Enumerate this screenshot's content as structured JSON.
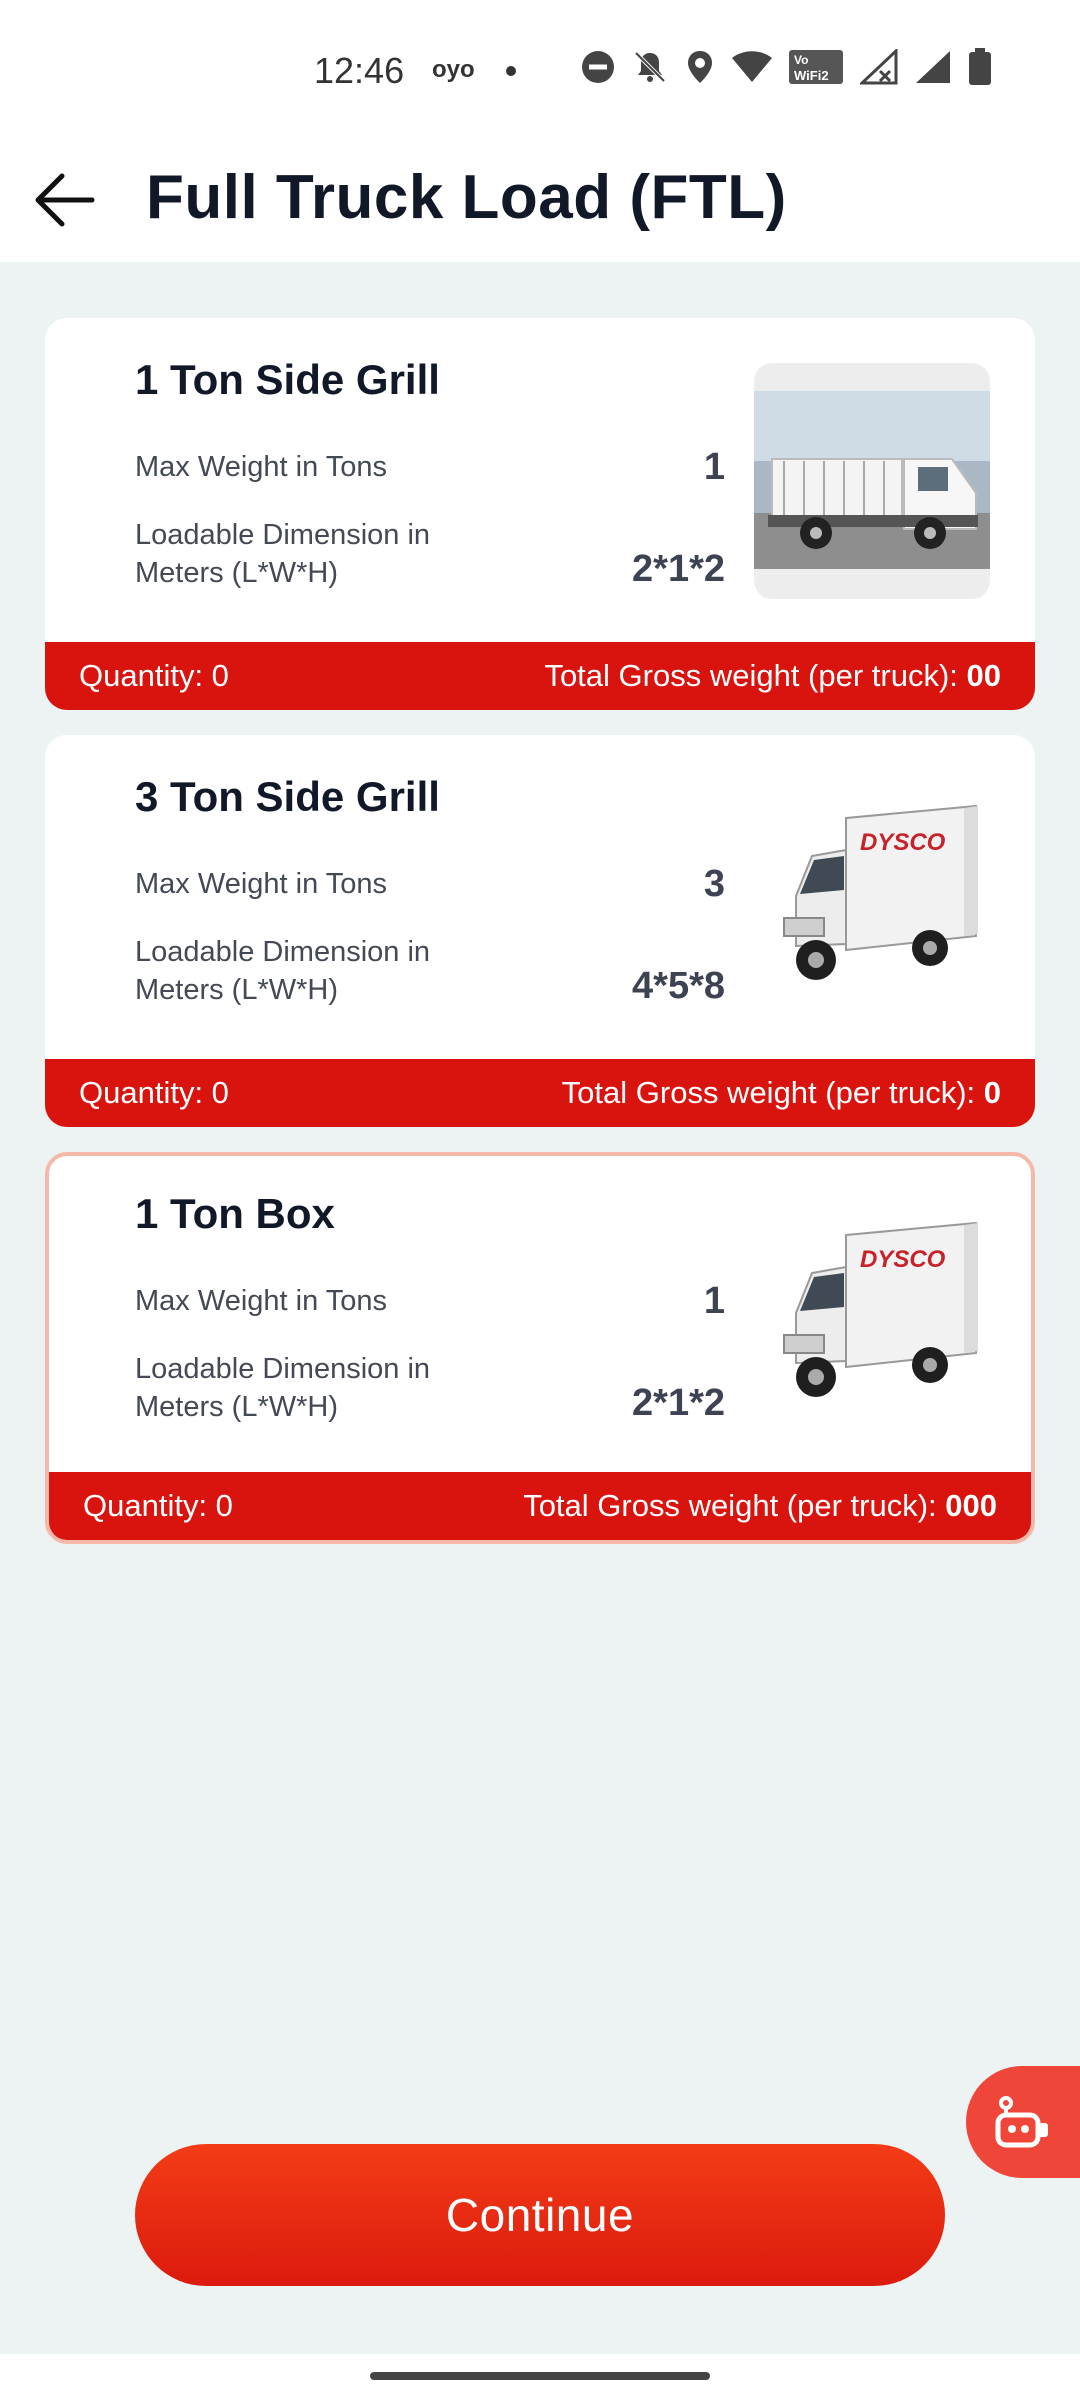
{
  "status_bar": {
    "time": "12:46",
    "carrier": "oyo"
  },
  "header": {
    "title": "Full Truck Load (FTL)",
    "back_icon": "arrow-left-icon"
  },
  "cards": [
    {
      "title": "1 Ton Side Grill",
      "max_weight_label": "Max Weight in Tons",
      "max_weight_value": "1",
      "dimension_label": "Loadable Dimension in Meters (L*W*H)",
      "dimension_value": "2*1*2",
      "quantity": "Quantity: 0",
      "gross_label": "Total Gross weight (per truck): ",
      "gross_value": "00",
      "selected": false
    },
    {
      "title": "3 Ton Side Grill",
      "max_weight_label": "Max Weight in Tons",
      "max_weight_value": "3",
      "dimension_label": "Loadable Dimension in Meters (L*W*H)",
      "dimension_value": "4*5*8",
      "quantity": "Quantity: 0",
      "gross_label": "Total Gross weight (per truck): ",
      "gross_value": "0",
      "selected": false
    },
    {
      "title": "1 Ton Box",
      "max_weight_label": "Max Weight in Tons",
      "max_weight_value": "1",
      "dimension_label": "Loadable Dimension in Meters (L*W*H)",
      "dimension_value": "2*1*2",
      "quantity": "Quantity: 0",
      "gross_label": "Total Gross weight (per truck): ",
      "gross_value": "000",
      "selected": true
    }
  ],
  "continue_label": "Continue",
  "colors": {
    "accent": "#d9140f",
    "button_top": "#f33c16",
    "fab": "#f0463a"
  }
}
